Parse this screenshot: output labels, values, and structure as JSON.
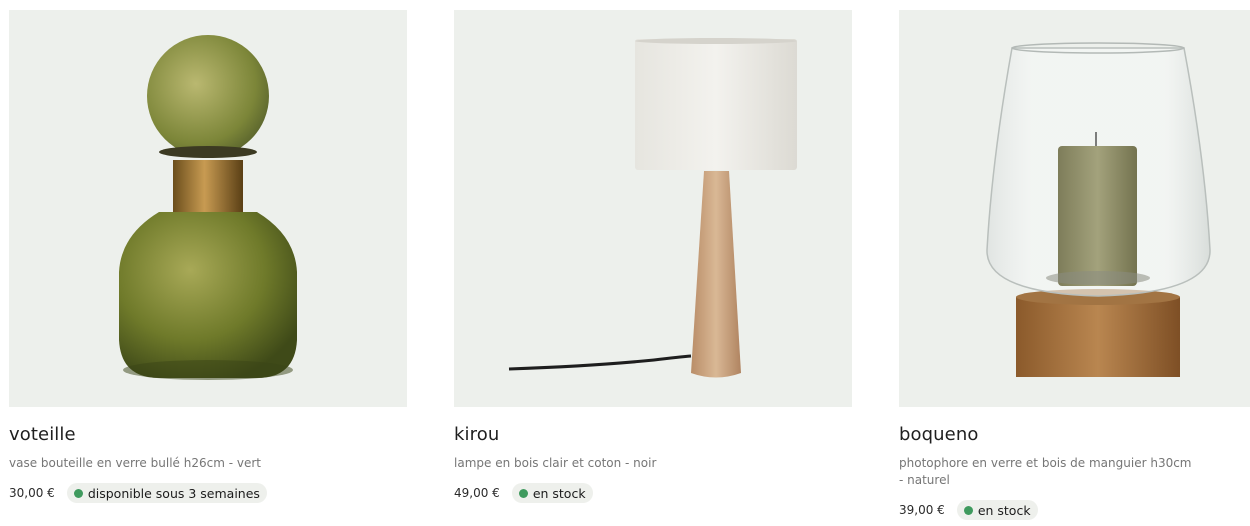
{
  "products": [
    {
      "name": "voteille",
      "description": "vase bouteille en verre bullé h26cm - vert",
      "price": "30,00 €",
      "availability": "disponible sous 3 semaines",
      "image_icon": "vase-bottle-image"
    },
    {
      "name": "kirou",
      "description": "lampe en bois clair et coton - noir",
      "price": "49,00 €",
      "availability": "en stock",
      "image_icon": "table-lamp-image"
    },
    {
      "name": "boqueno",
      "description": "photophore en verre et bois de manguier h30cm - naturel",
      "price": "39,00 €",
      "availability": "en stock",
      "image_icon": "hurricane-candle-holder-image"
    }
  ],
  "colors": {
    "image_background": "#edf0ec",
    "availability_dot": "#3f9a5e",
    "badge_background": "#eef0ec"
  }
}
